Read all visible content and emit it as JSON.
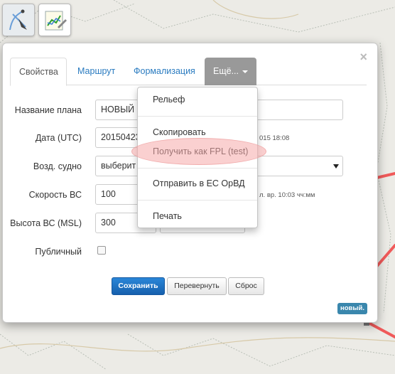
{
  "toolbar": {
    "route_tool_icon": "route-edit-icon",
    "plan_tool_icon": "flight-plan-icon"
  },
  "dialog": {
    "close_label": "×",
    "tabs": [
      {
        "label": "Свойства",
        "active": true
      },
      {
        "label": "Маршрут",
        "active": false
      },
      {
        "label": "Формализация",
        "active": false
      },
      {
        "label": "Ещё...",
        "active": false
      }
    ],
    "form": {
      "plan_name": {
        "label": "Название плана",
        "value": "НОВЫЙ П"
      },
      "date": {
        "label": "Дата (UTC)",
        "value": "20150423",
        "hint": "015 18:08"
      },
      "aircraft": {
        "label": "Возд. судно",
        "value": "выберит"
      },
      "speed": {
        "label": "Скорость ВС",
        "value": "100",
        "hint": "л. вр. 10:03 чч:мм"
      },
      "altitude": {
        "label": "Высота ВС (MSL)",
        "value": "300"
      },
      "public": {
        "label": "Публичный",
        "checked": false
      }
    },
    "buttons": {
      "save": "Сохранить",
      "flip": "Перевернуть",
      "reset": "Сброс"
    },
    "badge": "новый."
  },
  "more_menu": {
    "items": [
      "Рельеф",
      "Скопировать",
      "Получить как FPL (test)",
      "Отправить в ЕС ОрВД",
      "Печать"
    ],
    "highlighted_index": 2
  },
  "colors": {
    "route_line": "#f05a5a",
    "accent_link": "#2a7bc0",
    "save_button": "#1a6fc1",
    "badge": "#3a87ad"
  }
}
